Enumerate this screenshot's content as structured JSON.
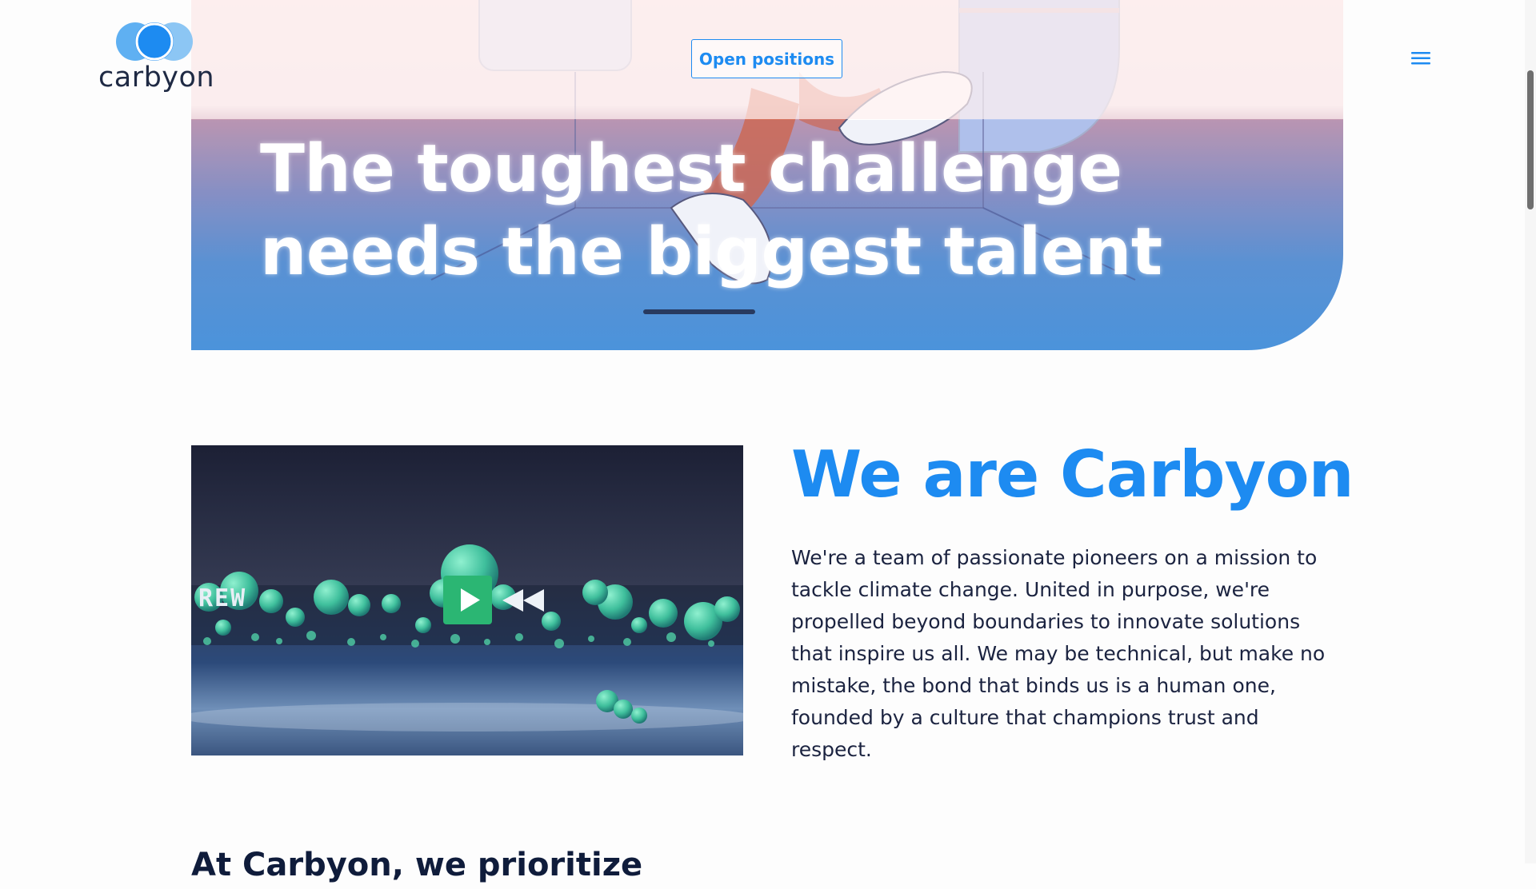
{
  "brand": {
    "logo_text": "carbyon",
    "accent": "#1d8bf1",
    "dark": "#1f2a44"
  },
  "header": {
    "open_positions_label": "Open positions",
    "menu_icon": "hamburger-menu-icon"
  },
  "hero": {
    "title_line1": "The toughest challenge",
    "title_line2": "needs the biggest talent"
  },
  "intro": {
    "video_overlay_text": "REW",
    "title": "We are Carbyon",
    "body": "We're a team of passionate pioneers on a mission to tackle climate change. United in purpose, we're propelled beyond boundaries to innovate solutions that inspire us all. We may be technical, but make no mistake, the bond that binds us is a human one, founded by a culture that champions trust and respect."
  },
  "next_section": {
    "heading": "At Carbyon, we prioritize"
  }
}
